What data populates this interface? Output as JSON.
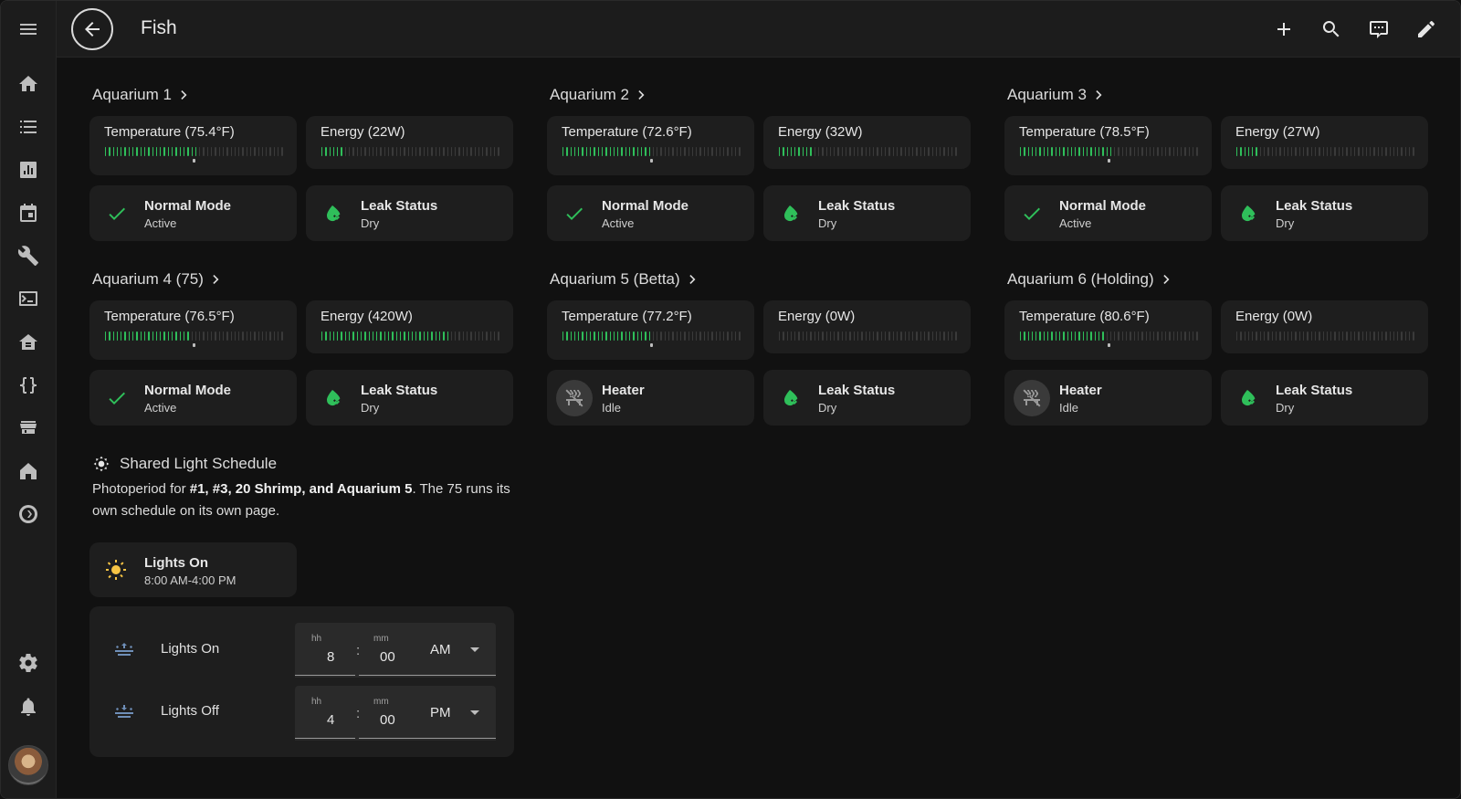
{
  "header": {
    "title": "Fish"
  },
  "aquariums": [
    {
      "name": "Aquarium 1",
      "temperature": "Temperature (75.4°F)",
      "temp_level": 0.53,
      "energy": "Energy (22W)",
      "energy_level": 0.12,
      "mode": {
        "name": "Normal Mode",
        "state": "Active"
      },
      "leak": {
        "name": "Leak Status",
        "state": "Dry"
      }
    },
    {
      "name": "Aquarium 2",
      "temperature": "Temperature (72.6°F)",
      "temp_level": 0.5,
      "energy": "Energy (32W)",
      "energy_level": 0.19,
      "mode": {
        "name": "Normal Mode",
        "state": "Active"
      },
      "leak": {
        "name": "Leak Status",
        "state": "Dry"
      }
    },
    {
      "name": "Aquarium 3",
      "temperature": "Temperature (78.5°F)",
      "temp_level": 0.53,
      "energy": "Energy (27W)",
      "energy_level": 0.12,
      "mode": {
        "name": "Normal Mode",
        "state": "Active"
      },
      "leak": {
        "name": "Leak Status",
        "state": "Dry"
      }
    },
    {
      "name": "Aquarium 4 (75)",
      "temperature": "Temperature (76.5°F)",
      "temp_level": 0.47,
      "energy": "Energy (420W)",
      "energy_level": 0.72,
      "mode": {
        "name": "Normal Mode",
        "state": "Active"
      },
      "leak": {
        "name": "Leak Status",
        "state": "Dry"
      }
    },
    {
      "name": "Aquarium 5 (Betta)",
      "temperature": "Temperature (77.2°F)",
      "temp_level": 0.5,
      "energy": "Energy (0W)",
      "energy_level": 0,
      "mode": {
        "name": "Heater",
        "state": "Idle"
      },
      "leak": {
        "name": "Leak Status",
        "state": "Dry"
      }
    },
    {
      "name": "Aquarium 6 (Holding)",
      "temperature": "Temperature (80.6°F)",
      "temp_level": 0.47,
      "energy": "Energy (0W)",
      "energy_level": 0,
      "mode": {
        "name": "Heater",
        "state": "Idle"
      },
      "leak": {
        "name": "Leak Status",
        "state": "Dry"
      }
    }
  ],
  "light": {
    "title": "Shared Light Schedule",
    "desc_pre": "Photoperiod for ",
    "desc_bold": "#1, #3, 20 Shrimp, and Aquarium 5",
    "desc_post": ". The 75 runs its own schedule on its own page.",
    "tile": {
      "name": "Lights On",
      "state": "8:00 AM-4:00 PM"
    },
    "on": {
      "label": "Lights On",
      "hh_label": "hh",
      "mm_label": "mm",
      "hh": "8",
      "mm": "00",
      "ampm": "AM"
    },
    "off": {
      "label": "Lights Off",
      "hh_label": "hh",
      "mm_label": "mm",
      "hh": "4",
      "mm": "00",
      "ampm": "PM"
    }
  },
  "colors": {
    "accent_green": "#2fbf5a",
    "sun_yellow": "#f6c445",
    "schedule_icon": "#6f8fb8"
  }
}
